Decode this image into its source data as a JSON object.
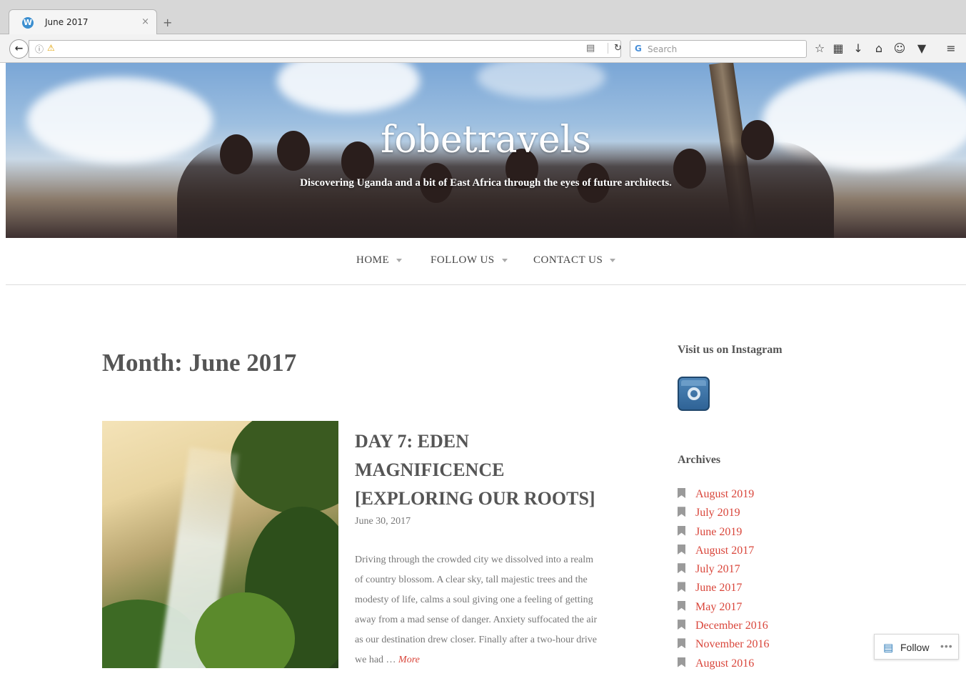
{
  "browser": {
    "tab_title": "June 2017",
    "tab_close": "×",
    "new_tab": "+",
    "search_placeholder": "Search",
    "icons": [
      "back-arrow",
      "info",
      "lock-warning",
      "reader-view",
      "reload",
      "search-engine",
      "bookmark-star",
      "reading-list",
      "download",
      "home",
      "chat",
      "pocket",
      "menu"
    ]
  },
  "site": {
    "title": "fobetravels",
    "tagline": "Discovering Uganda and a bit of East Africa through the eyes of future architects."
  },
  "nav": {
    "items": [
      {
        "label": "HOME"
      },
      {
        "label": "FOLLOW US"
      },
      {
        "label": "CONTACT US"
      }
    ]
  },
  "main": {
    "page_title": "Month: June 2017",
    "post": {
      "title": "DAY 7: EDEN MAGNIFICENCE [EXPLORING OUR ROOTS]",
      "date": "June 30, 2017",
      "excerpt": "Driving through the crowded city we dissolved into a realm of country blossom.  A clear sky, tall majestic trees and the modesty of life, calms a soul giving one a feeling of getting away from a mad sense of danger. Anxiety suffocated the air as our destination drew closer. Finally after a two-hour drive we had …",
      "more_label": "More"
    }
  },
  "sidebar": {
    "instagram_title": "Visit us on Instagram",
    "archives_title": "Archives",
    "archives": [
      "August 2019",
      "July 2019",
      "June 2019",
      "August 2017",
      "July 2017",
      "June 2017",
      "May 2017",
      "December 2016",
      "November 2016",
      "August 2016"
    ]
  },
  "follow_widget": {
    "label": "Follow",
    "more": "•••"
  },
  "colors": {
    "link": "#d9453a",
    "text": "#555555",
    "muted": "#777777"
  }
}
